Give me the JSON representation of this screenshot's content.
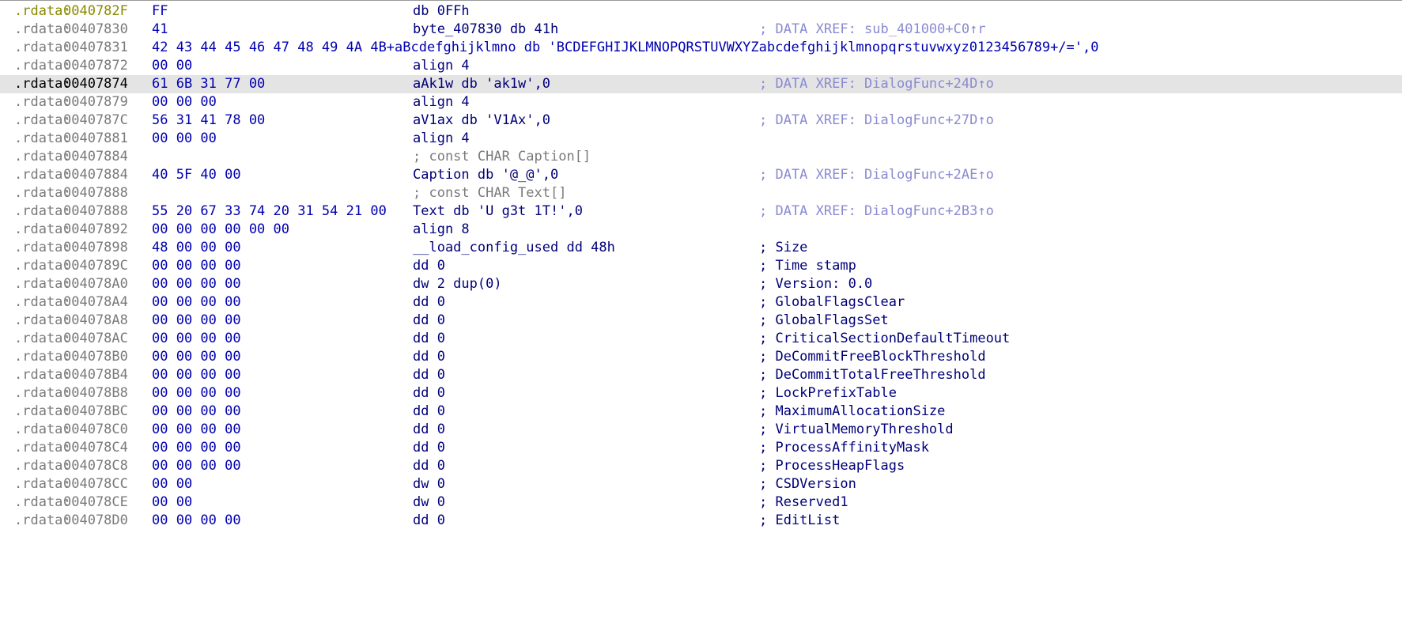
{
  "listing": {
    "rows": [
      {
        "seg": ".rdata",
        "addr": "0040782F",
        "bytes": "FF",
        "instr": "db 0FFh",
        "comment": ""
      },
      {
        "seg": ".rdata",
        "addr": "00407830",
        "bytes": "41",
        "instr": "byte_407830 db 41h",
        "comment": "; DATA XREF: sub_401000+C0↑r"
      },
      {
        "seg": ".rdata",
        "addr": "00407831",
        "bytes": "42 43 44 45 46 47 48 49 4A 4B+aBcdefghijklmno db 'BCDEFGHIJKLMNOPQRSTUVWXYZabcdefghijklmnopqrstuvwxyz0123456789+/=',0",
        "instr": "",
        "comment": ""
      },
      {
        "seg": ".rdata",
        "addr": "00407872",
        "bytes": "00 00",
        "instr": "align 4",
        "comment": ""
      },
      {
        "seg": ".rdata",
        "addr": "00407874",
        "bytes": "61 6B 31 77 00",
        "instr": "aAk1w db 'ak1w',0",
        "comment": "; DATA XREF: DialogFunc+24D↑o"
      },
      {
        "seg": ".rdata",
        "addr": "00407879",
        "bytes": "00 00 00",
        "instr": "align 4",
        "comment": ""
      },
      {
        "seg": ".rdata",
        "addr": "0040787C",
        "bytes": "56 31 41 78 00",
        "instr": "aV1ax db 'V1Ax',0",
        "comment": "; DATA XREF: DialogFunc+27D↑o"
      },
      {
        "seg": ".rdata",
        "addr": "00407881",
        "bytes": "00 00 00",
        "instr": "align 4",
        "comment": ""
      },
      {
        "seg": ".rdata",
        "addr": "00407884",
        "bytes": "",
        "instr": "; const CHAR Caption[]",
        "comment": ""
      },
      {
        "seg": ".rdata",
        "addr": "00407884",
        "bytes": "40 5F 40 00",
        "instr": "Caption db '@_@',0",
        "comment": "; DATA XREF: DialogFunc+2AE↑o"
      },
      {
        "seg": ".rdata",
        "addr": "00407888",
        "bytes": "",
        "instr": "; const CHAR Text[]",
        "comment": ""
      },
      {
        "seg": ".rdata",
        "addr": "00407888",
        "bytes": "55 20 67 33 74 20 31 54 21 00",
        "instr": "Text db 'U g3t 1T!',0",
        "comment": "; DATA XREF: DialogFunc+2B3↑o"
      },
      {
        "seg": ".rdata",
        "addr": "00407892",
        "bytes": "00 00 00 00 00 00",
        "instr": "align 8",
        "comment": ""
      },
      {
        "seg": ".rdata",
        "addr": "00407898",
        "bytes": "48 00 00 00",
        "instr": "__load_config_used dd 48h",
        "comment": "; Size"
      },
      {
        "seg": ".rdata",
        "addr": "0040789C",
        "bytes": "00 00 00 00",
        "instr": "dd 0",
        "comment": "; Time stamp"
      },
      {
        "seg": ".rdata",
        "addr": "004078A0",
        "bytes": "00 00 00 00",
        "instr": "dw 2 dup(0)",
        "comment": "; Version: 0.0"
      },
      {
        "seg": ".rdata",
        "addr": "004078A4",
        "bytes": "00 00 00 00",
        "instr": "dd 0",
        "comment": "; GlobalFlagsClear"
      },
      {
        "seg": ".rdata",
        "addr": "004078A8",
        "bytes": "00 00 00 00",
        "instr": "dd 0",
        "comment": "; GlobalFlagsSet"
      },
      {
        "seg": ".rdata",
        "addr": "004078AC",
        "bytes": "00 00 00 00",
        "instr": "dd 0",
        "comment": "; CriticalSectionDefaultTimeout"
      },
      {
        "seg": ".rdata",
        "addr": "004078B0",
        "bytes": "00 00 00 00",
        "instr": "dd 0",
        "comment": "; DeCommitFreeBlockThreshold"
      },
      {
        "seg": ".rdata",
        "addr": "004078B4",
        "bytes": "00 00 00 00",
        "instr": "dd 0",
        "comment": "; DeCommitTotalFreeThreshold"
      },
      {
        "seg": ".rdata",
        "addr": "004078B8",
        "bytes": "00 00 00 00",
        "instr": "dd 0",
        "comment": "; LockPrefixTable"
      },
      {
        "seg": ".rdata",
        "addr": "004078BC",
        "bytes": "00 00 00 00",
        "instr": "dd 0",
        "comment": "; MaximumAllocationSize"
      },
      {
        "seg": ".rdata",
        "addr": "004078C0",
        "bytes": "00 00 00 00",
        "instr": "dd 0",
        "comment": "; VirtualMemoryThreshold"
      },
      {
        "seg": ".rdata",
        "addr": "004078C4",
        "bytes": "00 00 00 00",
        "instr": "dd 0",
        "comment": "; ProcessAffinityMask"
      },
      {
        "seg": ".rdata",
        "addr": "004078C8",
        "bytes": "00 00 00 00",
        "instr": "dd 0",
        "comment": "; ProcessHeapFlags"
      },
      {
        "seg": ".rdata",
        "addr": "004078CC",
        "bytes": "00 00",
        "instr": "dw 0",
        "comment": "; CSDVersion"
      },
      {
        "seg": ".rdata",
        "addr": "004078CE",
        "bytes": "00 00",
        "instr": "dw 0",
        "comment": "; Reserved1"
      },
      {
        "seg": ".rdata",
        "addr": "004078D0",
        "bytes": "00 00 00 00",
        "instr": "dd 0",
        "comment": "; EditList"
      }
    ],
    "highlighted_addr": "00407874"
  },
  "colors": {
    "background": "#ffffff",
    "highlight": "#e4e4e4",
    "address": "#7a7a7a",
    "bytes": "#0000b0",
    "instruction": "#00007a",
    "string": "#007000",
    "xref_comment": "#8a8ad0"
  }
}
